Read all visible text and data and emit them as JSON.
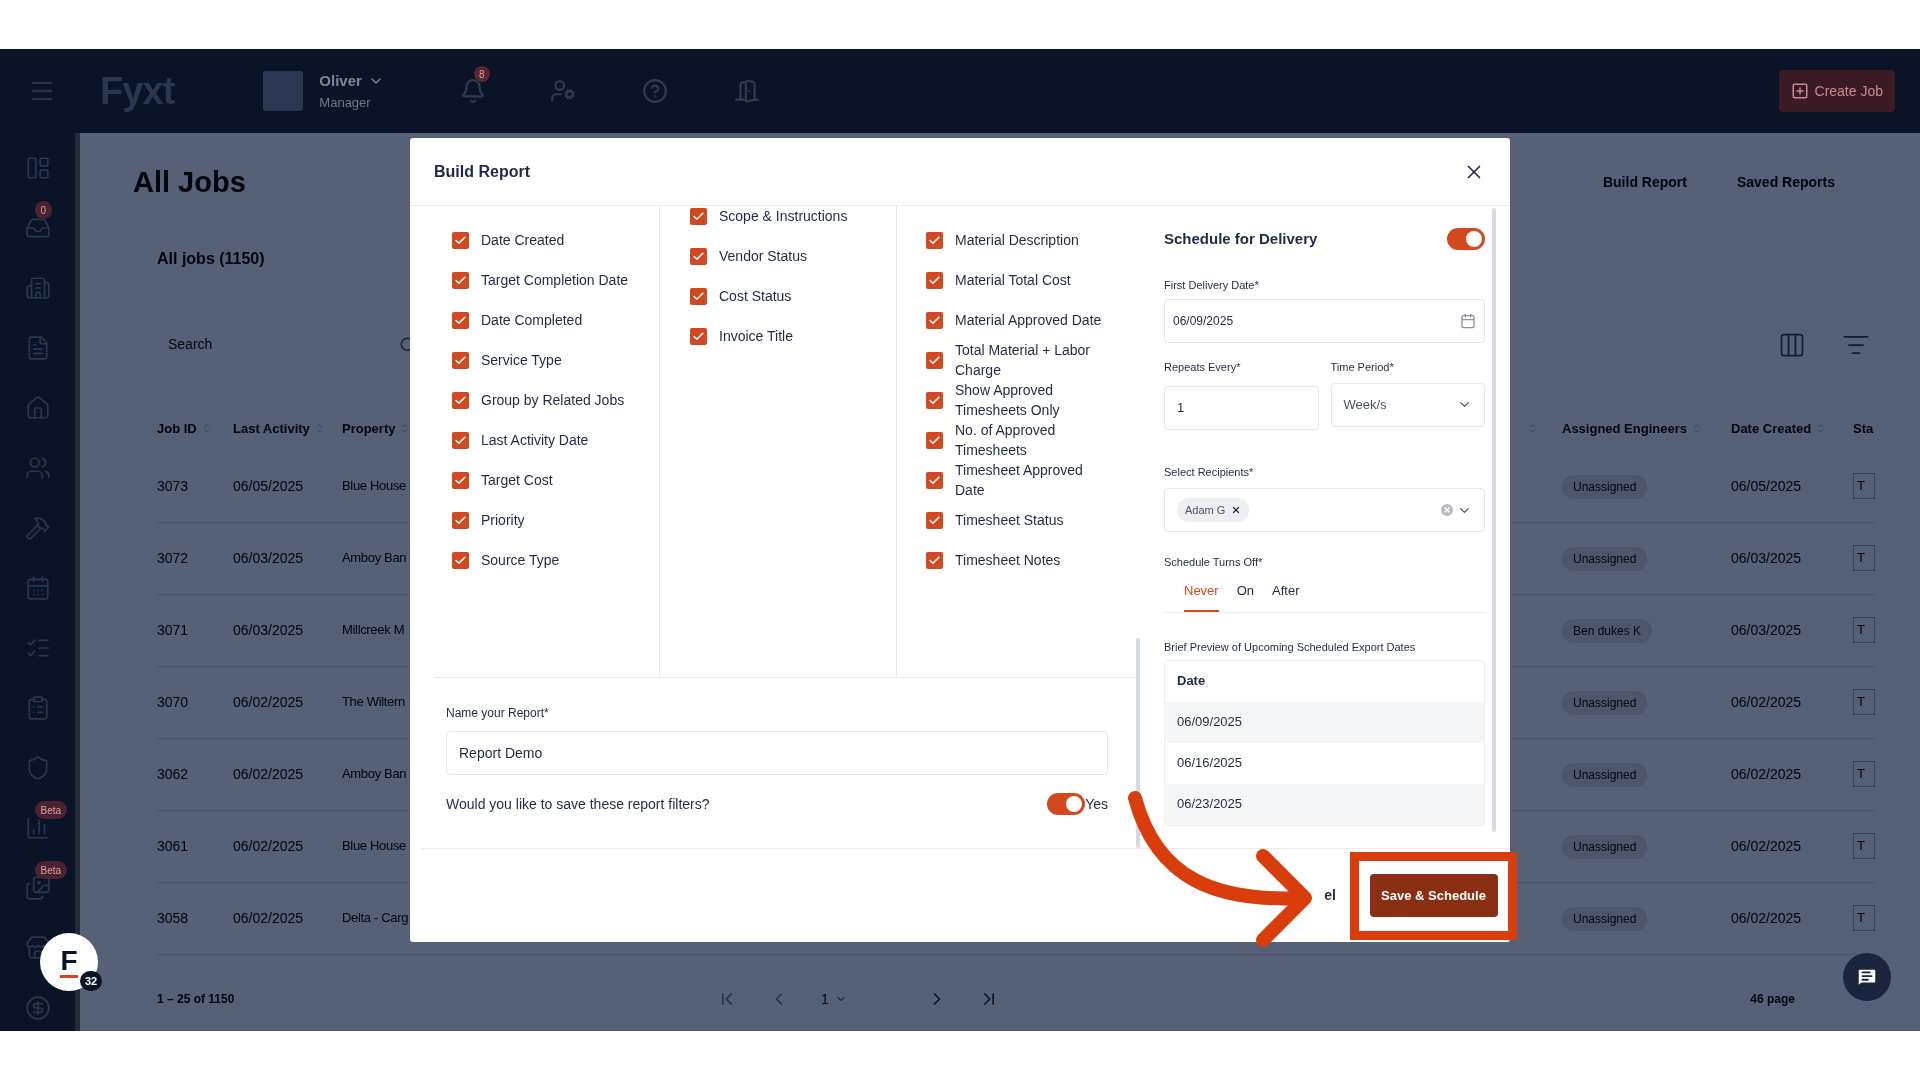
{
  "topbar": {
    "logo": "Fyxt",
    "user": {
      "name": "Oliver",
      "role": "Manager"
    },
    "notifications": {
      "count": "8"
    },
    "create_button": "Create Job"
  },
  "sidebar": {
    "items": [
      {
        "kind": "dashboard"
      },
      {
        "kind": "inbox",
        "badge": "0"
      },
      {
        "kind": "buildings"
      },
      {
        "kind": "file"
      },
      {
        "kind": "home"
      },
      {
        "kind": "users"
      },
      {
        "kind": "tools"
      },
      {
        "kind": "calendar"
      },
      {
        "kind": "checklist"
      },
      {
        "kind": "clipboard"
      },
      {
        "kind": "shield"
      },
      {
        "kind": "chart",
        "badge": "Beta"
      },
      {
        "kind": "images",
        "badge": "Beta"
      },
      {
        "kind": "store"
      },
      {
        "kind": "dollar"
      }
    ]
  },
  "page": {
    "title": "All Jobs",
    "tabs": [
      {
        "label": "Build Report"
      },
      {
        "label": "Saved Reports"
      }
    ],
    "subtitle": "All jobs (1150)",
    "search": {
      "placeholder": "Search"
    },
    "table": {
      "columns": [
        "Job ID",
        "Last Activity",
        "Property",
        "Assigned Engineers",
        "Date Created",
        "Sta"
      ],
      "rows": [
        {
          "job_id": "3073",
          "last_activity": "06/05/2025",
          "property": "Blue House",
          "engineer": "Unassigned",
          "date_created": "06/05/2025",
          "status": "T"
        },
        {
          "job_id": "3072",
          "last_activity": "06/03/2025",
          "property": "Amboy Ban",
          "engineer": "Unassigned",
          "date_created": "06/03/2025",
          "status": "T"
        },
        {
          "job_id": "3071",
          "last_activity": "06/03/2025",
          "property": "Millcreek M",
          "engineer": "Ben dukes K",
          "date_created": "06/03/2025",
          "status": "T"
        },
        {
          "job_id": "3070",
          "last_activity": "06/02/2025",
          "property": "The Wiltern",
          "engineer": "Unassigned",
          "date_created": "06/02/2025",
          "status": "T"
        },
        {
          "job_id": "3062",
          "last_activity": "06/02/2025",
          "property": "Amboy Ban",
          "engineer": "Unassigned",
          "date_created": "06/02/2025",
          "status": "T"
        },
        {
          "job_id": "3061",
          "last_activity": "06/02/2025",
          "property": "Blue House",
          "engineer": "Unassigned",
          "date_created": "06/02/2025",
          "status": "T"
        },
        {
          "job_id": "3058",
          "last_activity": "06/02/2025",
          "property": "Delta - Carg",
          "engineer": "Unassigned",
          "date_created": "06/02/2025",
          "status": "T"
        }
      ]
    },
    "pagination": {
      "range": "1 – 25 of 1150",
      "page": "1",
      "pages": "46 page"
    }
  },
  "floating_badge": {
    "letter": "F",
    "count": "32"
  },
  "modal": {
    "title": "Build Report",
    "columns": [
      {
        "items": [
          {
            "label": "Date Created",
            "checked": true
          },
          {
            "label": "Target Completion Date",
            "checked": true
          },
          {
            "label": "Date Completed",
            "checked": true
          },
          {
            "label": "Service Type",
            "checked": true
          },
          {
            "label": "Group by Related Jobs",
            "checked": true
          },
          {
            "label": "Last Activity Date",
            "checked": true
          },
          {
            "label": "Target Cost",
            "checked": true
          },
          {
            "label": "Priority",
            "checked": true
          },
          {
            "label": "Source Type",
            "checked": true
          }
        ]
      },
      {
        "items": [
          {
            "label": "Scope & Instructions",
            "checked": true
          },
          {
            "label": "Vendor Status",
            "checked": true
          },
          {
            "label": "Cost Status",
            "checked": true
          },
          {
            "label": "Invoice Title",
            "checked": true
          }
        ]
      },
      {
        "items": [
          {
            "label": "Material Description",
            "checked": true
          },
          {
            "label": "Material Total Cost",
            "checked": true
          },
          {
            "label": "Material Approved Date",
            "checked": true
          },
          {
            "label": "Total Material + Labor Charge",
            "checked": true
          },
          {
            "label": "Show Approved Timesheets Only",
            "checked": true
          },
          {
            "label": "No. of Approved Timesheets",
            "checked": true
          },
          {
            "label": "Timesheet Approved Date",
            "checked": true
          },
          {
            "label": "Timesheet Status",
            "checked": true
          },
          {
            "label": "Timesheet Notes",
            "checked": true
          }
        ]
      }
    ],
    "name_field": {
      "label": "Name your Report*",
      "value": "Report Demo"
    },
    "save_filters": {
      "question": "Would you like to save these report filters?",
      "on": true,
      "answer": "Yes"
    },
    "schedule": {
      "title": "Schedule for Delivery",
      "on": true,
      "first_date": {
        "label": "First Delivery Date*",
        "value": "06/09/2025"
      },
      "repeats": {
        "label": "Repeats Every*",
        "value": "1"
      },
      "period": {
        "label": "Time Period*",
        "value": "Week/s"
      },
      "recipients": {
        "label": "Select Recipients*",
        "chips": [
          "Adam G"
        ]
      },
      "turns_off": {
        "label": "Schedule Turns Off*",
        "options": [
          {
            "label": "Never",
            "selected": true
          },
          {
            "label": "On",
            "selected": false
          },
          {
            "label": "After",
            "selected": false
          }
        ]
      },
      "preview": {
        "label": "Brief Preview of Upcoming Scheduled Export Dates",
        "header": "Date",
        "rows": [
          "06/09/2025",
          "06/16/2025",
          "06/23/2025"
        ]
      }
    },
    "footer": {
      "cancel": "el",
      "save": "Save & Schedule"
    }
  }
}
